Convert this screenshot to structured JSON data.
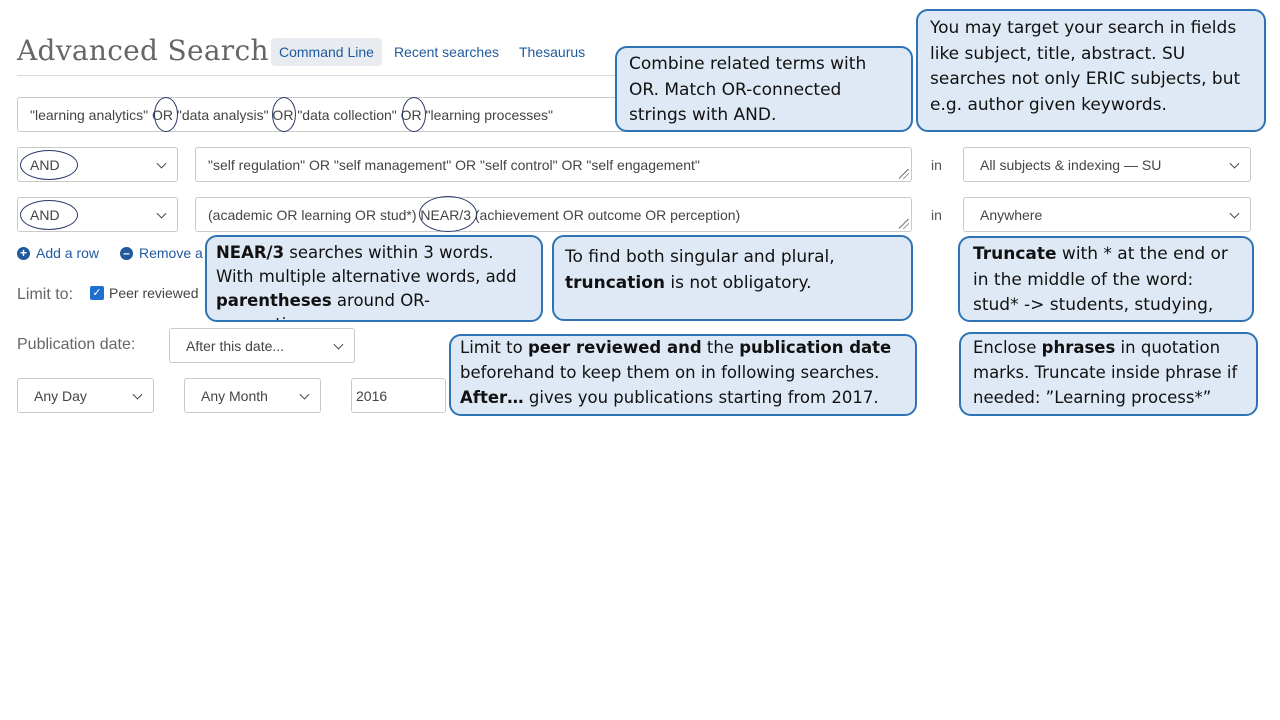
{
  "page": {
    "title": "Advanced Search",
    "tabs": [
      "Command Line",
      "Recent searches",
      "Thesaurus"
    ]
  },
  "search": {
    "row1_value": "\"learning analytics\" OR \"data analysis\" OR \"data collection\" OR \"learning processes\"",
    "row2_operator": "AND",
    "row2_value": "\"self regulation\" OR \"self management\" OR \"self control\" OR \"self engagement\"",
    "row2_in": "in",
    "row2_field": "All subjects & indexing — SU",
    "row3_operator": "AND",
    "row3_value": "(academic OR learning OR stud*) NEAR/3 (achievement OR outcome OR perception)",
    "row3_in": "in",
    "row3_field": "Anywhere",
    "add_row": "Add a row",
    "remove_row": "Remove a"
  },
  "limits": {
    "label": "Limit to:",
    "peer_reviewed": "Peer reviewed"
  },
  "publication": {
    "label": "Publication date:",
    "mode": "After this date...",
    "day": "Any Day",
    "month": "Any Month",
    "year": "2016"
  },
  "callouts": {
    "fields": "You may target your search in fields like subject, title, abstract. SU searches not only ERIC subjects, but e.g. author given keywords.",
    "or_and": "Combine related terms with OR. Match OR-connected strings with AND.",
    "near_bold": "NEAR/3",
    "near_1": " searches within 3 words. With multiple alternative words, add ",
    "near_bold2": "parentheses",
    "near_2": " around OR-connections.",
    "plural_1": "To find both singular and plural, ",
    "plural_bold": "truncation",
    "plural_2": "  is not obligatory.",
    "trunc_bold": "Truncate",
    "trunc_1": " with * at the end or in the middle of the word: stud* -> students, studying, etc.",
    "limit_1": "Limit to ",
    "limit_bold1": "peer reviewed and",
    "limit_2": " the ",
    "limit_bold2": "publication  date",
    "limit_3": " beforehand to keep them on in following searches. ",
    "limit_bold3": "After…",
    "limit_4": " gives you publications starting from 2017.",
    "phrase_1": "Enclose ",
    "phrase_bold": "phrases",
    "phrase_2": " in quotation marks. Truncate inside phrase if needed: ”Learning process*”"
  }
}
